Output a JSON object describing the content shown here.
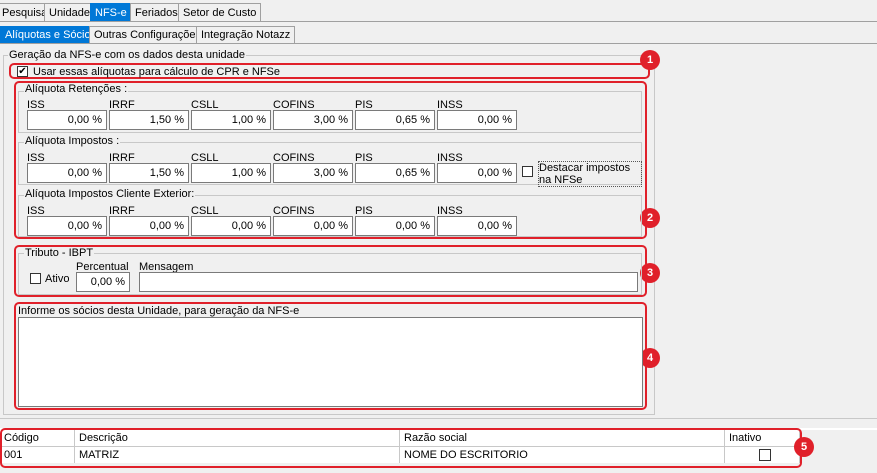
{
  "tabs_top": [
    "Pesquisa",
    "Unidade",
    "NFS-e",
    "Feriados",
    "Setor de Custo"
  ],
  "tabs_sub": [
    "Alíquotas e Sócios",
    "Outras Configurações",
    "Integração Notazz"
  ],
  "main_group": {
    "title": "Geração da NFS-e com os dados desta unidade",
    "use_rates_label": "Usar essas alíquotas para cálculo de CPR e NFSe",
    "use_rates_checked": true
  },
  "column_labels": [
    "ISS",
    "IRRF",
    "CSLL",
    "COFINS",
    "PIS",
    "INSS"
  ],
  "retencoes": {
    "title": "Alíquota Retenções  :",
    "values": [
      "0,00 %",
      "1,50 %",
      "1,00 %",
      "3,00 %",
      "0,65 %",
      "0,00 %"
    ]
  },
  "impostos": {
    "title": "Alíquota Impostos :",
    "values": [
      "0,00 %",
      "1,50 %",
      "1,00 %",
      "3,00 %",
      "0,65 %",
      "0,00 %"
    ],
    "destacar_label": "Destacar impostos na NFSe",
    "destacar_checked": false
  },
  "exterior": {
    "title": "Alíquota Impostos Cliente Exterior:",
    "values": [
      "0,00 %",
      "0,00 %",
      "0,00 %",
      "0,00 %",
      "0,00 %",
      "0,00 %"
    ]
  },
  "ibpt": {
    "title": "Tributo - IBPT",
    "ativo_label": "Ativo",
    "ativo_checked": false,
    "percentual_label": "Percentual",
    "percentual_value": "0,00 %",
    "mensagem_label": "Mensagem",
    "mensagem_value": ""
  },
  "socios": {
    "title": "Informe os sócios desta Unidade, para geração da NFS-e",
    "text": ""
  },
  "grid": {
    "headers": [
      "Código",
      "Descrição",
      "Razão social",
      "Inativo"
    ],
    "rows": [
      {
        "codigo": "001",
        "descricao": "MATRIZ",
        "razao": "NOME DO ESCRITORIO",
        "inativo": false
      }
    ]
  },
  "badges": [
    "1",
    "2",
    "3",
    "4",
    "5"
  ],
  "colors": {
    "accent": "#0078d7",
    "highlight": "#e0202a"
  }
}
